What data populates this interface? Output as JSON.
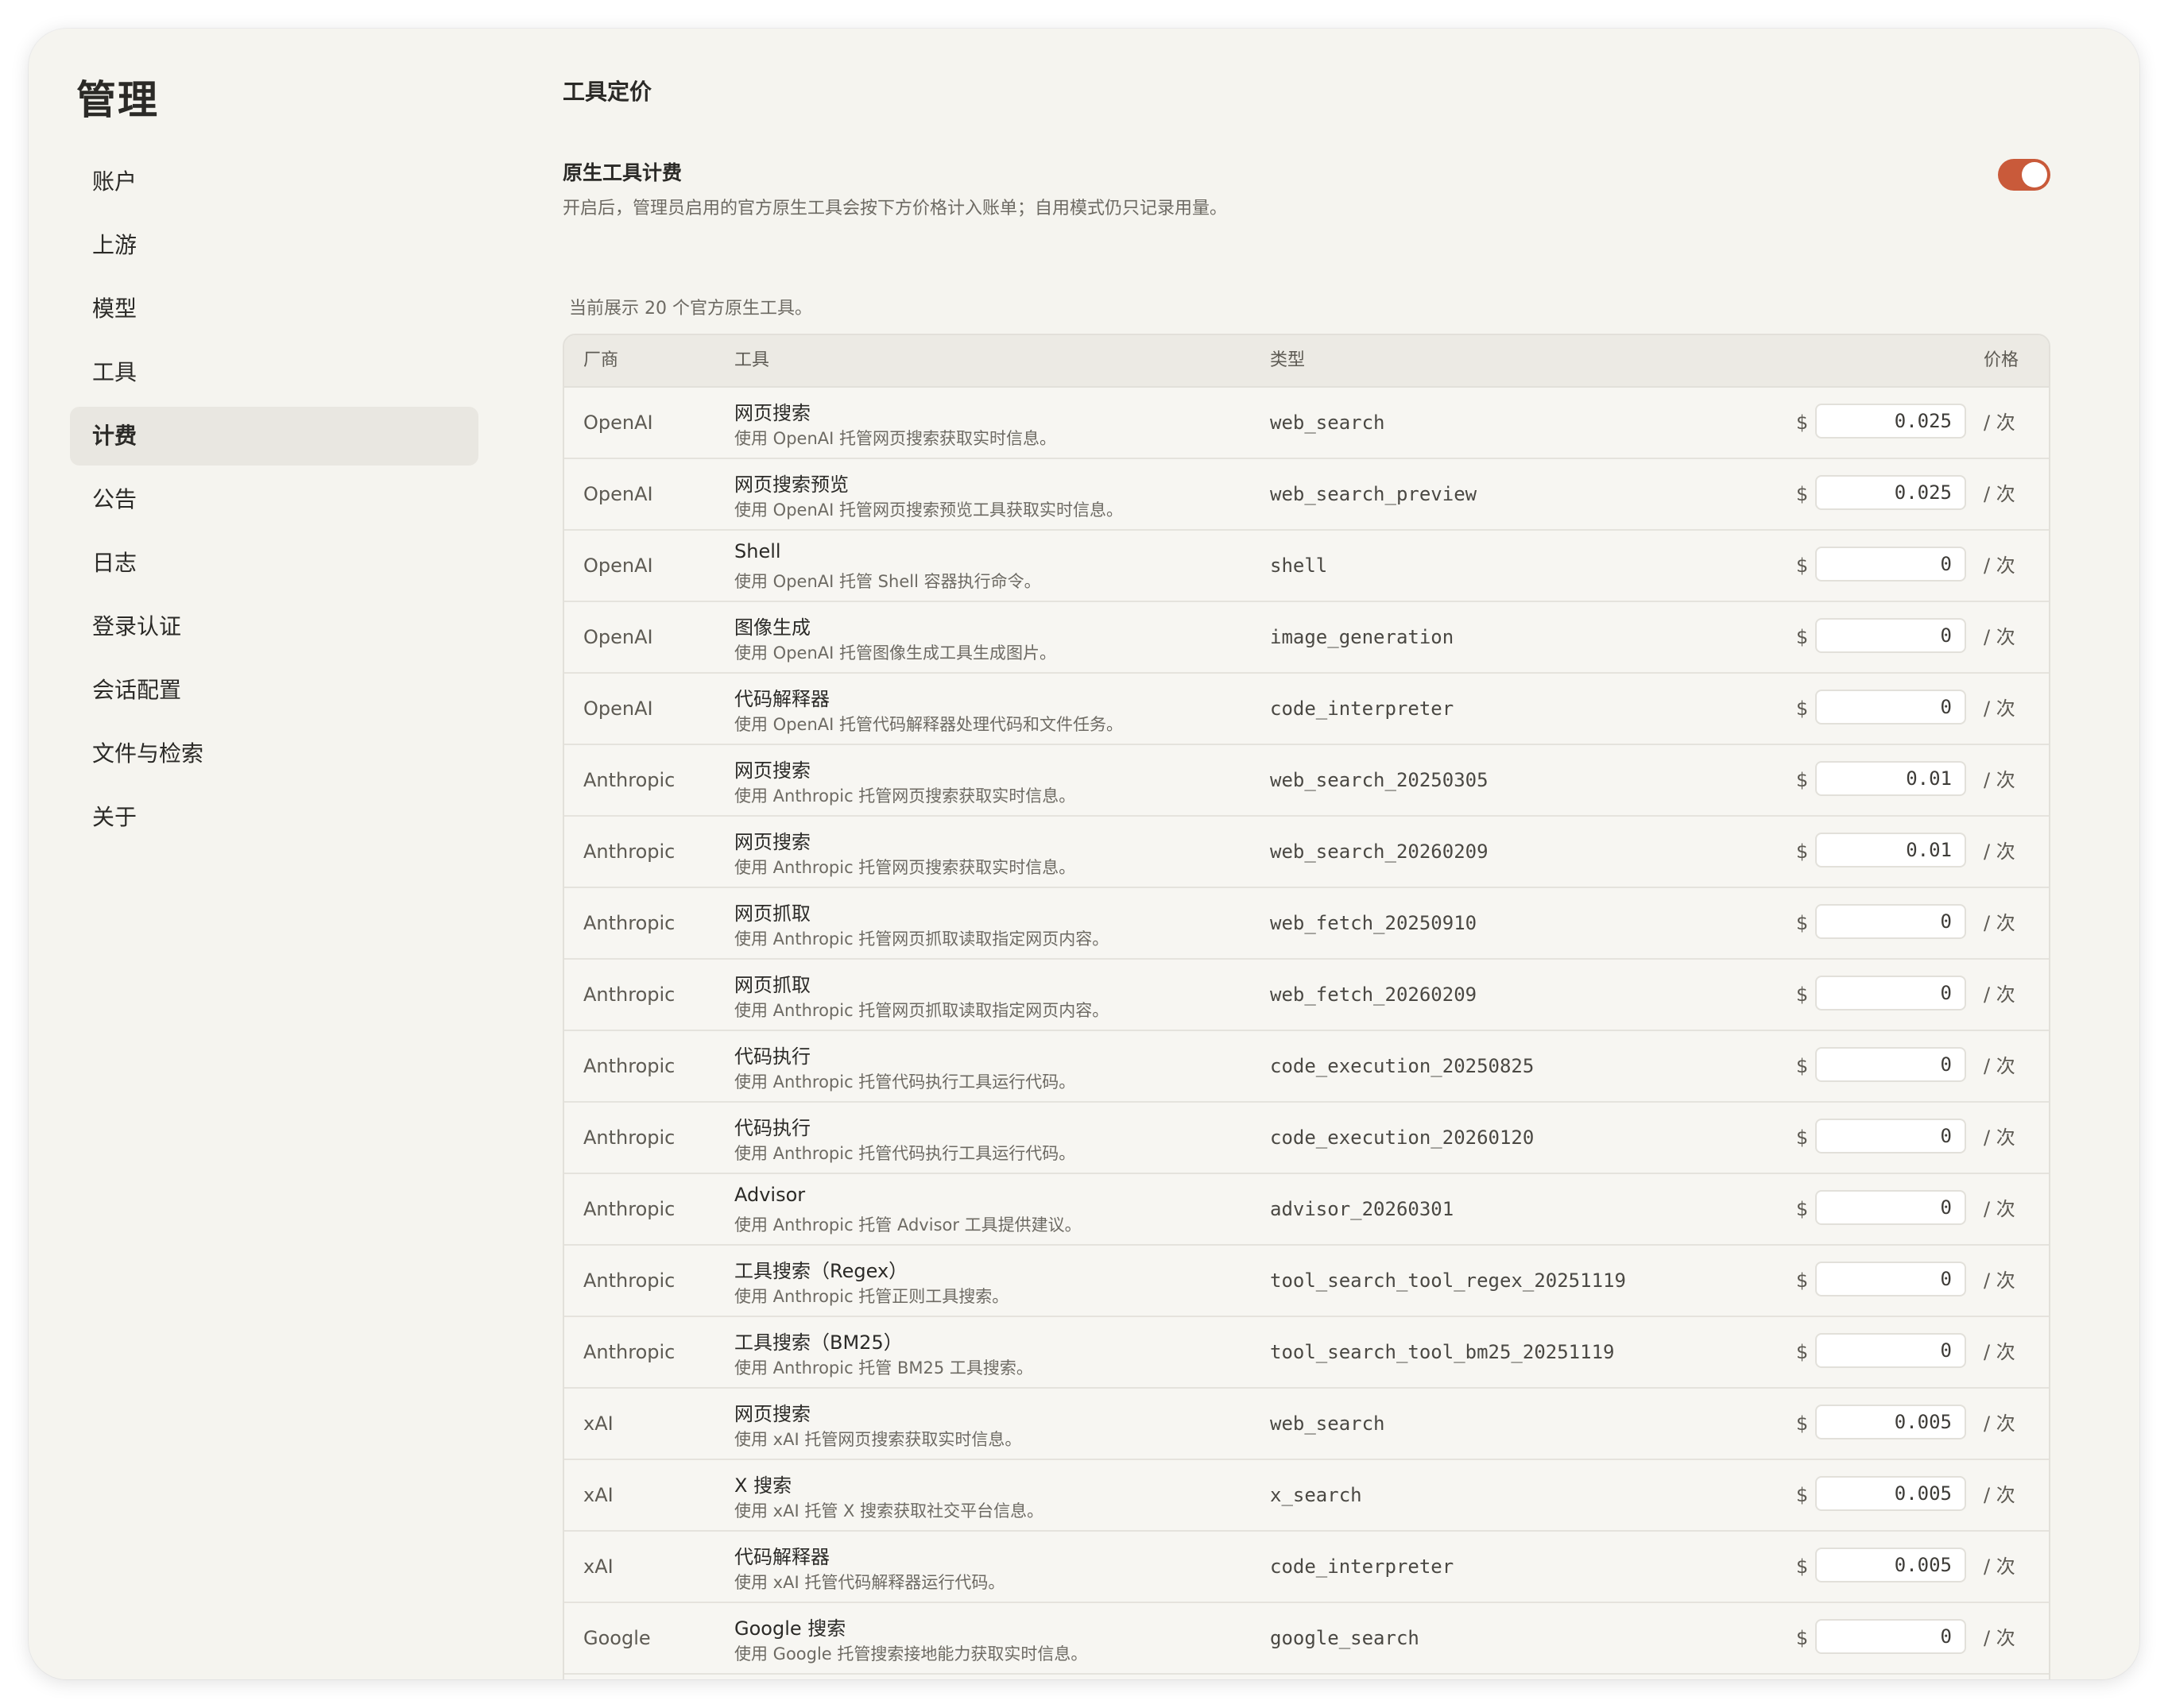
{
  "sidebar": {
    "title": "管理",
    "items": [
      {
        "label": "账户",
        "active": false
      },
      {
        "label": "上游",
        "active": false
      },
      {
        "label": "模型",
        "active": false
      },
      {
        "label": "工具",
        "active": false
      },
      {
        "label": "计费",
        "active": true
      },
      {
        "label": "公告",
        "active": false
      },
      {
        "label": "日志",
        "active": false
      },
      {
        "label": "登录认证",
        "active": false
      },
      {
        "label": "会话配置",
        "active": false
      },
      {
        "label": "文件与检索",
        "active": false
      },
      {
        "label": "关于",
        "active": false
      }
    ]
  },
  "main": {
    "title": "工具定价",
    "billing_toggle": {
      "label": "原生工具计费",
      "description": "开启后，管理员启用的官方原生工具会按下方价格计入账单；自用模式仍只记录用量。",
      "enabled": true,
      "color": "#c95a3a"
    },
    "count_text": "当前展示 20 个官方原生工具。",
    "table": {
      "headers": {
        "vendor": "厂商",
        "tool": "工具",
        "type": "类型",
        "price": "价格"
      },
      "currency": "$",
      "unit": "/  次",
      "rows": [
        {
          "vendor": "OpenAI",
          "name": "网页搜索",
          "desc": "使用 OpenAI 托管网页搜索获取实时信息。",
          "type": "web_search",
          "price": "0.025"
        },
        {
          "vendor": "OpenAI",
          "name": "网页搜索预览",
          "desc": "使用 OpenAI 托管网页搜索预览工具获取实时信息。",
          "type": "web_search_preview",
          "price": "0.025"
        },
        {
          "vendor": "OpenAI",
          "name": "Shell",
          "desc": "使用 OpenAI 托管 Shell 容器执行命令。",
          "type": "shell",
          "price": "0"
        },
        {
          "vendor": "OpenAI",
          "name": "图像生成",
          "desc": "使用 OpenAI 托管图像生成工具生成图片。",
          "type": "image_generation",
          "price": "0"
        },
        {
          "vendor": "OpenAI",
          "name": "代码解释器",
          "desc": "使用 OpenAI 托管代码解释器处理代码和文件任务。",
          "type": "code_interpreter",
          "price": "0"
        },
        {
          "vendor": "Anthropic",
          "name": "网页搜索",
          "desc": "使用 Anthropic 托管网页搜索获取实时信息。",
          "type": "web_search_20250305",
          "price": "0.01"
        },
        {
          "vendor": "Anthropic",
          "name": "网页搜索",
          "desc": "使用 Anthropic 托管网页搜索获取实时信息。",
          "type": "web_search_20260209",
          "price": "0.01"
        },
        {
          "vendor": "Anthropic",
          "name": "网页抓取",
          "desc": "使用 Anthropic 托管网页抓取读取指定网页内容。",
          "type": "web_fetch_20250910",
          "price": "0"
        },
        {
          "vendor": "Anthropic",
          "name": "网页抓取",
          "desc": "使用 Anthropic 托管网页抓取读取指定网页内容。",
          "type": "web_fetch_20260209",
          "price": "0"
        },
        {
          "vendor": "Anthropic",
          "name": "代码执行",
          "desc": "使用 Anthropic 托管代码执行工具运行代码。",
          "type": "code_execution_20250825",
          "price": "0"
        },
        {
          "vendor": "Anthropic",
          "name": "代码执行",
          "desc": "使用 Anthropic 托管代码执行工具运行代码。",
          "type": "code_execution_20260120",
          "price": "0"
        },
        {
          "vendor": "Anthropic",
          "name": "Advisor",
          "desc": "使用 Anthropic 托管 Advisor 工具提供建议。",
          "type": "advisor_20260301",
          "price": "0"
        },
        {
          "vendor": "Anthropic",
          "name": "工具搜索（Regex）",
          "desc": "使用 Anthropic 托管正则工具搜索。",
          "type": "tool_search_tool_regex_20251119",
          "price": "0"
        },
        {
          "vendor": "Anthropic",
          "name": "工具搜索（BM25）",
          "desc": "使用 Anthropic 托管 BM25 工具搜索。",
          "type": "tool_search_tool_bm25_20251119",
          "price": "0"
        },
        {
          "vendor": "xAI",
          "name": "网页搜索",
          "desc": "使用 xAI 托管网页搜索获取实时信息。",
          "type": "web_search",
          "price": "0.005"
        },
        {
          "vendor": "xAI",
          "name": "X 搜索",
          "desc": "使用 xAI 托管 X 搜索获取社交平台信息。",
          "type": "x_search",
          "price": "0.005"
        },
        {
          "vendor": "xAI",
          "name": "代码解释器",
          "desc": "使用 xAI 托管代码解释器运行代码。",
          "type": "code_interpreter",
          "price": "0.005"
        },
        {
          "vendor": "Google",
          "name": "Google 搜索",
          "desc": "使用 Google 托管搜索接地能力获取实时信息。",
          "type": "google_search",
          "price": "0"
        }
      ]
    }
  }
}
